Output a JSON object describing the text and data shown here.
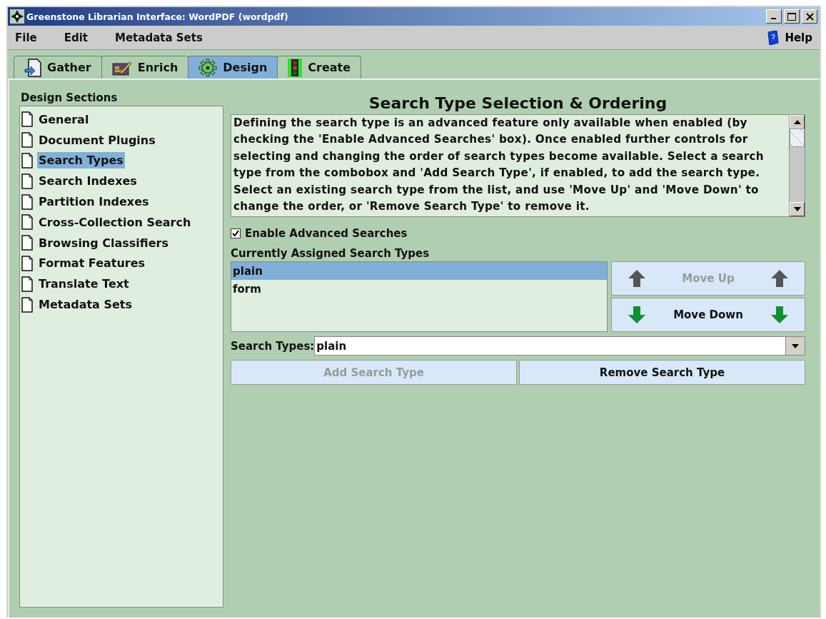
{
  "window": {
    "title": "Greenstone Librarian Interface: WordPDF (wordpdf)"
  },
  "menu": [
    {
      "label": "File"
    },
    {
      "label": "Edit"
    },
    {
      "label": "Metadata Sets"
    }
  ],
  "help": {
    "label": "Help"
  },
  "tabs": [
    {
      "label": "Gather",
      "kind": "gather",
      "selected": false
    },
    {
      "label": "Enrich",
      "kind": "enrich",
      "selected": false
    },
    {
      "label": "Design",
      "kind": "design",
      "selected": true
    },
    {
      "label": "Create",
      "kind": "create",
      "selected": false
    }
  ],
  "sidebar": {
    "heading": "Design Sections",
    "items": [
      {
        "label": "General",
        "selected": false
      },
      {
        "label": "Document Plugins",
        "selected": false
      },
      {
        "label": "Search Types",
        "selected": true
      },
      {
        "label": "Search Indexes",
        "selected": false
      },
      {
        "label": "Partition Indexes",
        "selected": false
      },
      {
        "label": "Cross-Collection Search",
        "selected": false
      },
      {
        "label": "Browsing Classifiers",
        "selected": false
      },
      {
        "label": "Format Features",
        "selected": false
      },
      {
        "label": "Translate Text",
        "selected": false
      },
      {
        "label": "Metadata Sets",
        "selected": false
      }
    ]
  },
  "panel": {
    "title": "Search Type Selection & Ordering",
    "description": "Defining the search type is an advanced feature only available when enabled (by checking the 'Enable Advanced Searches' box). Once enabled further controls for selecting and changing the order of search types become available. Select a search type from the combobox and 'Add Search Type', if enabled, to add the search type. Select an existing search type from the list, and use 'Move Up' and 'Move Down' to change the order, or 'Remove Search Type' to remove it.",
    "enable_checkbox": {
      "label": "Enable Advanced Searches",
      "checked": true
    },
    "assigned": {
      "label": "Currently Assigned Search Types",
      "items": [
        {
          "label": "plain",
          "selected": true
        },
        {
          "label": "form",
          "selected": false
        }
      ]
    },
    "move_up": {
      "label": "Move Up",
      "disabled": true
    },
    "move_down": {
      "label": "Move Down",
      "disabled": false
    },
    "search_types": {
      "label": "Search Types:",
      "value": "plain"
    },
    "add_button": {
      "label": "Add Search Type",
      "disabled": true
    },
    "remove_button": {
      "label": "Remove Search Type",
      "disabled": false
    }
  }
}
